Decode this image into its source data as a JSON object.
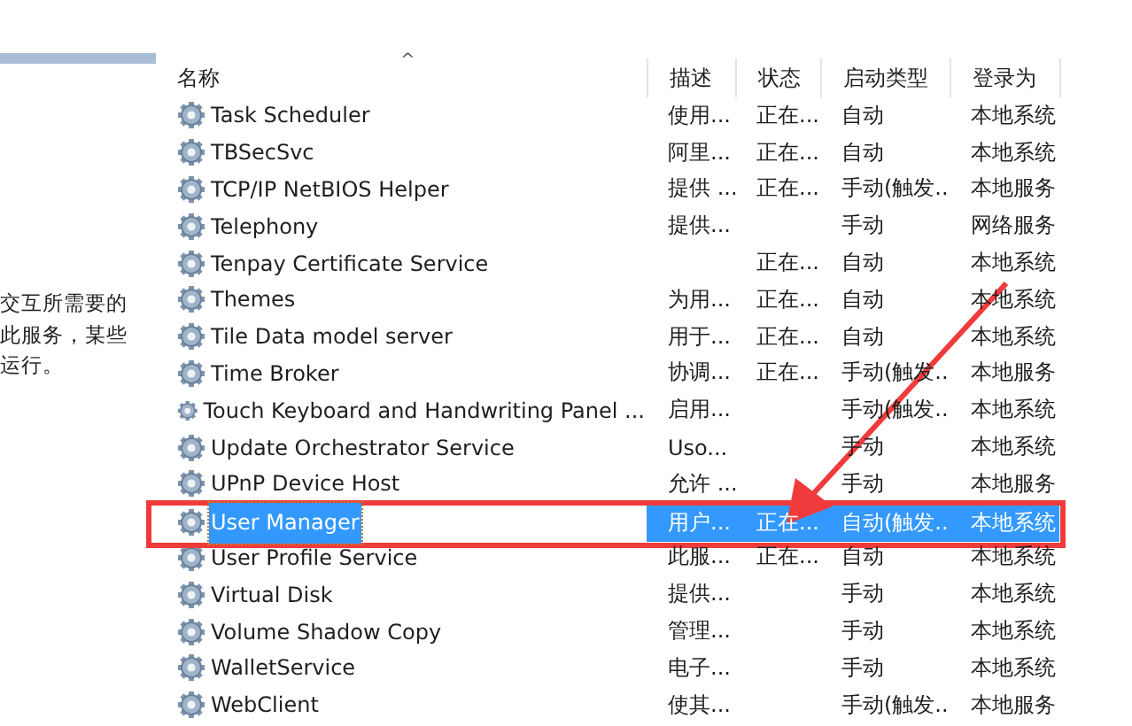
{
  "details_panel": {
    "description_lines": [
      "交互所需要的",
      "此服务，某些",
      "运行。"
    ]
  },
  "table": {
    "sort_indicator": "^",
    "columns": [
      "名称",
      "描述",
      "状态",
      "启动类型",
      "登录为"
    ],
    "rows": [
      {
        "name": "Task Scheduler",
        "description": "使用...",
        "status": "正在...",
        "startup": "自动",
        "logon": "本地系统",
        "selected": false
      },
      {
        "name": "TBSecSvc",
        "description": "阿里...",
        "status": "正在...",
        "startup": "自动",
        "logon": "本地系统",
        "selected": false
      },
      {
        "name": "TCP/IP NetBIOS Helper",
        "description": "提供 ...",
        "status": "正在...",
        "startup": "手动(触发...",
        "logon": "本地服务",
        "selected": false
      },
      {
        "name": "Telephony",
        "description": "提供...",
        "startup": "手动",
        "logon": "网络服务",
        "selected": false
      },
      {
        "name": "Tenpay Certificate Service",
        "status": "正在...",
        "startup": "自动",
        "logon": "本地系统",
        "selected": false
      },
      {
        "name": "Themes",
        "description": "为用...",
        "status": "正在...",
        "startup": "自动",
        "logon": "本地系统",
        "selected": false
      },
      {
        "name": "Tile Data model server",
        "description": "用于...",
        "status": "正在...",
        "startup": "自动",
        "logon": "本地系统",
        "selected": false
      },
      {
        "name": "Time Broker",
        "description": "协调...",
        "status": "正在...",
        "startup": "手动(触发...",
        "logon": "本地服务",
        "selected": false
      },
      {
        "name": "Touch Keyboard and Handwriting Panel ...",
        "description": "启用...",
        "startup": "手动(触发...",
        "logon": "本地系统",
        "selected": false
      },
      {
        "name": "Update Orchestrator Service",
        "description": "Uso...",
        "startup": "手动",
        "logon": "本地系统",
        "selected": false
      },
      {
        "name": "UPnP Device Host",
        "description": "允许 ...",
        "startup": "手动",
        "logon": "本地服务",
        "selected": false
      },
      {
        "name": "User Manager",
        "description": "用户...",
        "status": "正在...",
        "startup": "自动(触发...",
        "logon": "本地系统",
        "selected": true
      },
      {
        "name": "User Profile Service",
        "description": "此服...",
        "status": "正在...",
        "startup": "自动",
        "logon": "本地系统",
        "selected": false
      },
      {
        "name": "Virtual Disk",
        "description": "提供...",
        "startup": "手动",
        "logon": "本地系统",
        "selected": false
      },
      {
        "name": "Volume Shadow Copy",
        "description": "管理...",
        "startup": "手动",
        "logon": "本地系统",
        "selected": false
      },
      {
        "name": "WalletService",
        "description": "电子...",
        "startup": "手动",
        "logon": "本地系统",
        "selected": false
      },
      {
        "name": "WebClient",
        "description": "使其...",
        "startup": "手动(触发...",
        "logon": "本地服务",
        "selected": false
      }
    ]
  }
}
